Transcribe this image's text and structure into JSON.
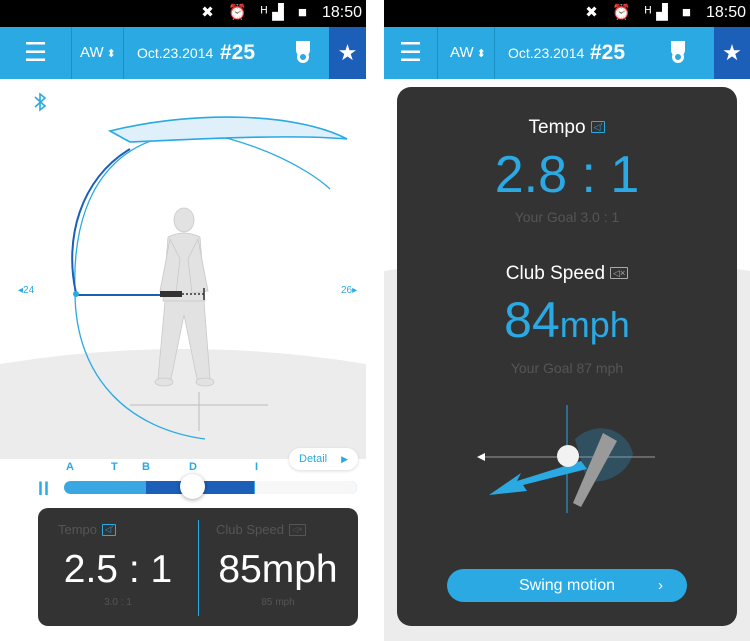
{
  "status_bar": {
    "icons": "✖ ⏰ ᴴ▟ ■",
    "time": "18:50"
  },
  "app_bar": {
    "menu_icon": "menu-icon",
    "club": "AW",
    "club_arrow": "⬍",
    "date": "Oct.23.2014",
    "swing_number": "#25",
    "trophy_icon": "trophy-icon",
    "star_icon": "star-icon"
  },
  "left": {
    "bluetooth_icon": "bluetooth-icon",
    "prev_label": "◂24",
    "next_label": "26▸",
    "phases": [
      "A",
      "T",
      "B",
      "D",
      "I"
    ],
    "progress": 0.44,
    "pause_icon": "ll",
    "detail_button": "Detail",
    "detail_arrow": "▶",
    "tempo": {
      "label": "Tempo",
      "value": "2.5 : 1",
      "goal": "3.0 : 1"
    },
    "club_speed": {
      "label": "Club Speed",
      "value": "85mph",
      "goal": "85 mph"
    }
  },
  "right": {
    "tempo": {
      "label": "Tempo",
      "value": "2.8 : 1",
      "goal": "Your  Goal 3.0 : 1"
    },
    "club_speed": {
      "label": "Club Speed",
      "value_number": "84",
      "value_unit": "mph",
      "goal": "Your  Goal 87 mph"
    },
    "swing_button": "Swing motion",
    "swing_arrow": "›"
  },
  "colors": {
    "accent": "#2aa9e3",
    "dark_accent": "#1b5fb8",
    "panel": "#333333"
  }
}
